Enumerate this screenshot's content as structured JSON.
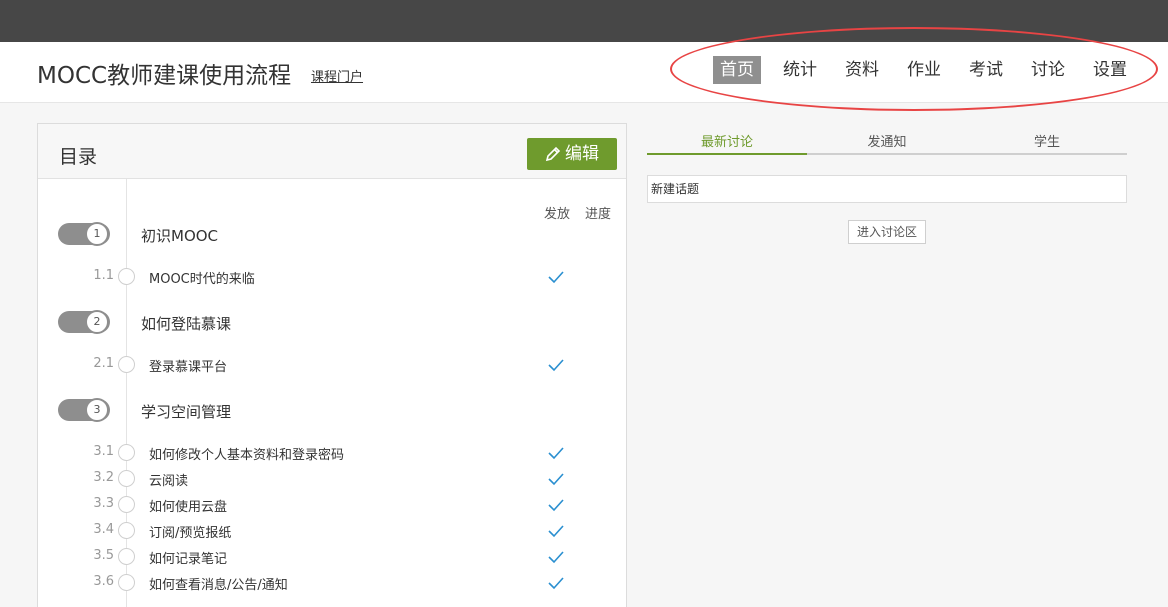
{
  "header": {
    "course_title": "MOCC教师建课使用流程",
    "portal_link": "课程门户",
    "nav": [
      "首页",
      "统计",
      "资料",
      "作业",
      "考试",
      "讨论",
      "设置"
    ],
    "active_nav": "首页"
  },
  "toc": {
    "title": "目录",
    "edit_label": "编辑",
    "col_publish": "发放",
    "col_progress": "进度",
    "chapters": [
      {
        "num": "1",
        "title": "初识MOOC",
        "sections": [
          {
            "num": "1.1",
            "title": "MOOC时代的来临",
            "published": true
          }
        ]
      },
      {
        "num": "2",
        "title": "如何登陆慕课",
        "sections": [
          {
            "num": "2.1",
            "title": "登录慕课平台",
            "published": true
          }
        ]
      },
      {
        "num": "3",
        "title": "学习空间管理",
        "sections": [
          {
            "num": "3.1",
            "title": "如何修改个人基本资料和登录密码",
            "published": true
          },
          {
            "num": "3.2",
            "title": "云阅读",
            "published": true
          },
          {
            "num": "3.3",
            "title": "如何使用云盘",
            "published": true
          },
          {
            "num": "3.4",
            "title": "订阅/预览报纸",
            "published": true
          },
          {
            "num": "3.5",
            "title": "如何记录笔记",
            "published": true
          },
          {
            "num": "3.6",
            "title": "如何查看消息/公告/通知",
            "published": true
          }
        ]
      }
    ]
  },
  "discussion": {
    "tabs": [
      "最新讨论",
      "发通知",
      "学生"
    ],
    "active_tab": "最新讨论",
    "new_topic_value": "新建话题",
    "enter_button": "进入讨论区"
  },
  "colors": {
    "accent": "#6f9b2d",
    "topbar": "#474747",
    "highlight": "#e84444",
    "check": "#2a8fd0"
  }
}
